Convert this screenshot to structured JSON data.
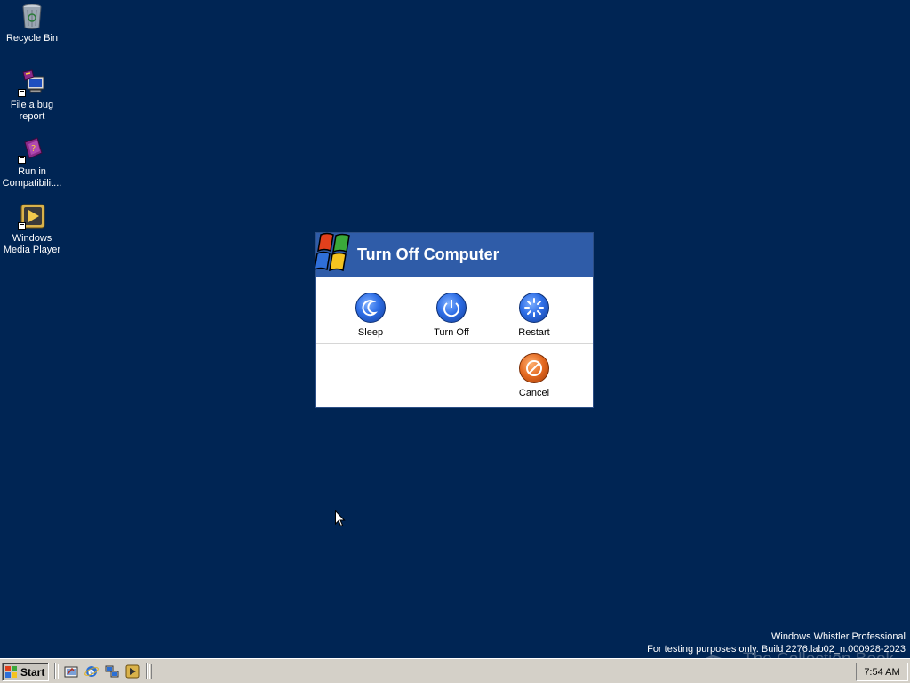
{
  "desktop": {
    "icons": [
      {
        "label": "Recycle Bin",
        "icon": "recycle-bin-icon"
      },
      {
        "label": "File a bug report",
        "icon": "bug-report-icon"
      },
      {
        "label": "Run in Compatibilit...",
        "icon": "compatibility-icon"
      },
      {
        "label": "Windows Media Player",
        "icon": "media-player-icon"
      }
    ],
    "background_color": "#002554"
  },
  "dialog": {
    "title": "Turn Off Computer",
    "options": [
      {
        "label": "Sleep",
        "icon": "sleep-moon-icon"
      },
      {
        "label": "Turn Off",
        "icon": "power-icon"
      },
      {
        "label": "Restart",
        "icon": "restart-icon"
      }
    ],
    "cancel_label": "Cancel",
    "header_color": "#2f5ca8"
  },
  "watermark": {
    "line1": "Windows Whistler Professional",
    "line2": "For testing purposes only. Build 2276.lab02_n.000928-2023",
    "collection": "The Collection Book"
  },
  "taskbar": {
    "start_label": "Start",
    "quick_launch": [
      "show-desktop-icon",
      "internet-explorer-icon",
      "network-icon",
      "media-player-icon"
    ],
    "clock": "7:54 AM"
  }
}
